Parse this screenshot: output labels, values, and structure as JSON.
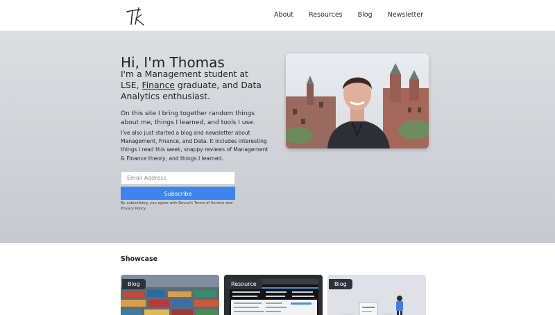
{
  "header": {
    "logo_text": "TK",
    "nav": [
      "About",
      "Resources",
      "Blog",
      "Newsletter"
    ]
  },
  "hero": {
    "title": "Hi, I'm Thomas",
    "subtitle_prefix": "I'm a Management student at LSE,",
    "subtitle_link": "Finance",
    "subtitle_suffix": " graduate, and Data Analytics enthusiast.",
    "paragraph1": "On this site I bring together random things about me, things I learned, and tools I use.",
    "paragraph2": "I've also just started a blog and newsletter about Management, Finance, and Data. It includes interesting things I read this week, snappy reviews of Management & Finance theory, and things I learned.",
    "email_placeholder": "Email Address",
    "subscribe_label": "Subscribe",
    "disclaimer": "By subscribing, you agree with Revue's Terms of Service and Privacy Policy."
  },
  "showcase": {
    "title": "Showcase",
    "cards": [
      {
        "badge": "Blog"
      },
      {
        "badge": "Resource"
      },
      {
        "badge": "Blog"
      }
    ]
  },
  "colors": {
    "accent": "#3a86ee",
    "badge_bg": "#2f3238",
    "hero_bg": "#d2d4d8"
  }
}
